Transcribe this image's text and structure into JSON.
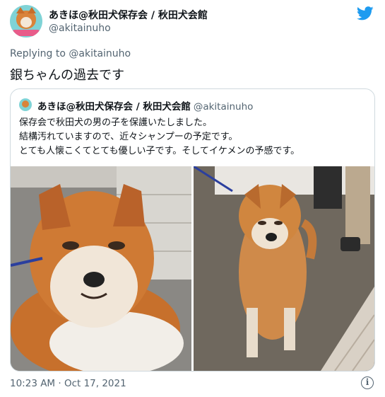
{
  "author": {
    "name": "あきほ@秋田犬保存会 / 秋田犬会館",
    "handle": "@akitainuho"
  },
  "reply": {
    "prefix": "Replying to",
    "handle": "@akitainuho"
  },
  "tweet": {
    "text": "銀ちゃんの過去です",
    "timestamp": "10:23 AM · Oct 17, 2021"
  },
  "quote": {
    "author_name": "あきほ@秋田犬保存会 / 秋田犬会館",
    "author_handle": "@akitainuho",
    "lines": [
      "保存会で秋田犬の男の子を保護いたしました。",
      "結構汚れていますので、近々シャンプーの予定です。",
      "とても人懐こくてとても優しい子です。そしてイケメンの予感です。"
    ],
    "photos": [
      {
        "alt": "akita-dog-closeup-photo"
      },
      {
        "alt": "akita-dog-standing-photo"
      }
    ]
  },
  "icons": {
    "platform": "twitter-bird-icon",
    "info": "info-icon"
  },
  "colors": {
    "brand": "#1d9bf0",
    "secondary_text": "#536471",
    "border": "#cfd9de"
  }
}
